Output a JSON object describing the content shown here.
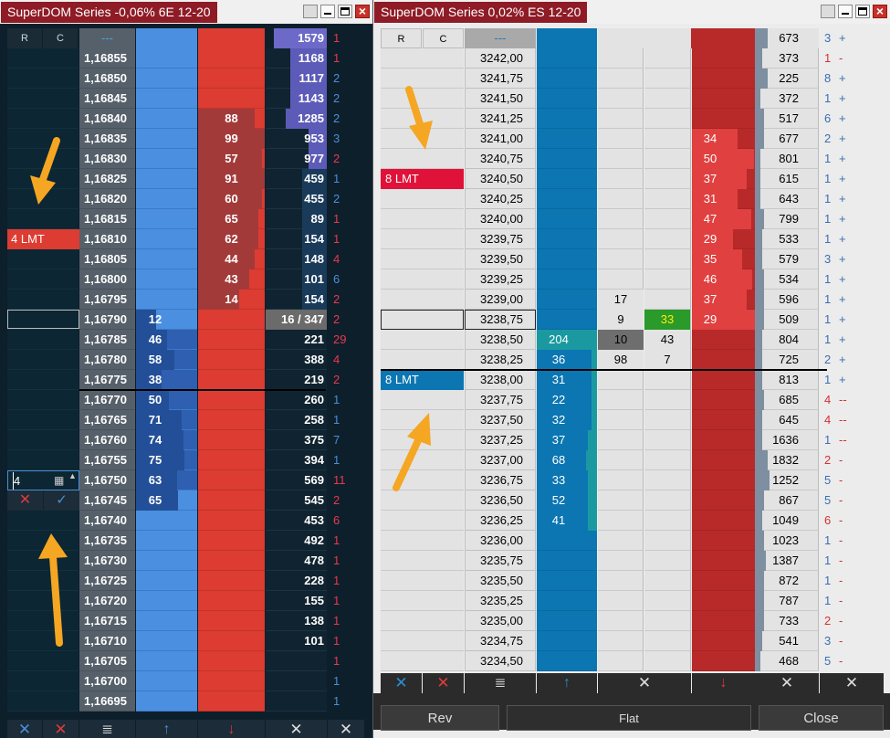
{
  "left": {
    "title": "SuperDOM Series -0,06% 6E 12-20",
    "header": {
      "r": "R",
      "c": "C",
      "price": "---",
      "top_ask": "1579",
      "top_cnt": "1"
    },
    "order_label": "4 LMT",
    "qty_value": "4",
    "rows": [
      {
        "p": "1,16855",
        "ask": "",
        "bid": "",
        "vol": "1168",
        "cnt": "1"
      },
      {
        "p": "1,16850",
        "ask": "",
        "bid": "",
        "vol": "1117",
        "cnt": "2"
      },
      {
        "p": "1,16845",
        "ask": "",
        "bid": "",
        "vol": "1143",
        "cnt": "2"
      },
      {
        "p": "1,16840",
        "ask": "88",
        "bid": "",
        "vol": "1285",
        "cnt": "2"
      },
      {
        "p": "1,16835",
        "ask": "99",
        "bid": "",
        "vol": "953",
        "cnt": "3"
      },
      {
        "p": "1,16830",
        "ask": "57",
        "bid": "",
        "vol": "977",
        "cnt": "2"
      },
      {
        "p": "1,16825",
        "ask": "91",
        "bid": "",
        "vol": "459",
        "cnt": "1"
      },
      {
        "p": "1,16820",
        "ask": "60",
        "bid": "",
        "vol": "455",
        "cnt": "2"
      },
      {
        "p": "1,16815",
        "ask": "65",
        "bid": "",
        "vol": "89",
        "cnt": "1"
      },
      {
        "p": "1,16810",
        "ask": "62",
        "bid": "",
        "vol": "154",
        "cnt": "1"
      },
      {
        "p": "1,16805",
        "ask": "44",
        "bid": "",
        "vol": "148",
        "cnt": "4"
      },
      {
        "p": "1,16800",
        "ask": "43",
        "bid": "",
        "vol": "101",
        "cnt": "6"
      },
      {
        "p": "1,16795",
        "ask": "14",
        "bid": "",
        "vol": "154",
        "cnt": "2"
      },
      {
        "p": "1,16790",
        "ask": "",
        "bid": "12",
        "vol": "16 / 347",
        "cnt": "2"
      },
      {
        "p": "1,16785",
        "ask": "",
        "bid": "46",
        "vol": "221",
        "cnt": "29"
      },
      {
        "p": "1,16780",
        "ask": "",
        "bid": "58",
        "vol": "388",
        "cnt": "4"
      },
      {
        "p": "1,16775",
        "ask": "",
        "bid": "38",
        "vol": "219",
        "cnt": "2"
      },
      {
        "p": "1,16770",
        "ask": "",
        "bid": "50",
        "vol": "260",
        "cnt": "1"
      },
      {
        "p": "1,16765",
        "ask": "",
        "bid": "71",
        "vol": "258",
        "cnt": "1"
      },
      {
        "p": "1,16760",
        "ask": "",
        "bid": "74",
        "vol": "375",
        "cnt": "7"
      },
      {
        "p": "1,16755",
        "ask": "",
        "bid": "75",
        "vol": "394",
        "cnt": "1"
      },
      {
        "p": "1,16750",
        "ask": "",
        "bid": "63",
        "vol": "569",
        "cnt": "11"
      },
      {
        "p": "1,16745",
        "ask": "",
        "bid": "65",
        "vol": "545",
        "cnt": "2"
      },
      {
        "p": "1,16740",
        "ask": "",
        "bid": "",
        "vol": "453",
        "cnt": "6"
      },
      {
        "p": "1,16735",
        "ask": "",
        "bid": "",
        "vol": "492",
        "cnt": "1"
      },
      {
        "p": "1,16730",
        "ask": "",
        "bid": "",
        "vol": "478",
        "cnt": "1"
      },
      {
        "p": "1,16725",
        "ask": "",
        "bid": "",
        "vol": "228",
        "cnt": "1"
      },
      {
        "p": "1,16720",
        "ask": "",
        "bid": "",
        "vol": "155",
        "cnt": "1"
      },
      {
        "p": "1,16715",
        "ask": "",
        "bid": "",
        "vol": "138",
        "cnt": "1"
      },
      {
        "p": "1,16710",
        "ask": "",
        "bid": "",
        "vol": "101",
        "cnt": "1"
      },
      {
        "p": "1,16705",
        "ask": "",
        "bid": "",
        "vol": "",
        "cnt": "1"
      },
      {
        "p": "1,16700",
        "ask": "",
        "bid": "",
        "vol": "",
        "cnt": "1"
      },
      {
        "p": "1,16695",
        "ask": "",
        "bid": "",
        "vol": "",
        "cnt": "1"
      }
    ]
  },
  "right": {
    "title": "SuperDOM Series 0,02% ES 12-20",
    "header": {
      "r": "R",
      "c": "C",
      "price": "---",
      "vol": "673",
      "cnt": "3",
      "sign": "+"
    },
    "order_label_sell": "8 LMT",
    "order_label_buy": "8 LMT",
    "rows": [
      {
        "p": "3242,00",
        "b1": "",
        "b2": "",
        "b3": "",
        "ask": "",
        "vol": "373",
        "cnt": "1",
        "sign": "-"
      },
      {
        "p": "3241,75",
        "b1": "",
        "b2": "",
        "b3": "",
        "ask": "",
        "vol": "225",
        "cnt": "8",
        "sign": "+"
      },
      {
        "p": "3241,50",
        "b1": "",
        "b2": "",
        "b3": "",
        "ask": "",
        "vol": "372",
        "cnt": "1",
        "sign": "+"
      },
      {
        "p": "3241,25",
        "b1": "",
        "b2": "",
        "b3": "",
        "ask": "",
        "vol": "517",
        "cnt": "6",
        "sign": "+"
      },
      {
        "p": "3241,00",
        "b1": "",
        "b2": "",
        "b3": "",
        "ask": "34",
        "vol": "677",
        "cnt": "2",
        "sign": "+"
      },
      {
        "p": "3240,75",
        "b1": "",
        "b2": "",
        "b3": "",
        "ask": "50",
        "vol": "801",
        "cnt": "1",
        "sign": "+"
      },
      {
        "p": "3240,50",
        "b1": "",
        "b2": "",
        "b3": "",
        "ask": "37",
        "vol": "615",
        "cnt": "1",
        "sign": "+"
      },
      {
        "p": "3240,25",
        "b1": "",
        "b2": "",
        "b3": "",
        "ask": "31",
        "vol": "643",
        "cnt": "1",
        "sign": "+"
      },
      {
        "p": "3240,00",
        "b1": "",
        "b2": "",
        "b3": "",
        "ask": "47",
        "vol": "799",
        "cnt": "1",
        "sign": "+"
      },
      {
        "p": "3239,75",
        "b1": "",
        "b2": "",
        "b3": "",
        "ask": "29",
        "vol": "533",
        "cnt": "1",
        "sign": "+"
      },
      {
        "p": "3239,50",
        "b1": "",
        "b2": "",
        "b3": "",
        "ask": "35",
        "vol": "579",
        "cnt": "3",
        "sign": "+"
      },
      {
        "p": "3239,25",
        "b1": "",
        "b2": "",
        "b3": "",
        "ask": "46",
        "vol": "534",
        "cnt": "1",
        "sign": "+"
      },
      {
        "p": "3239,00",
        "b1": "",
        "b2": "17",
        "b3": "",
        "ask": "37",
        "vol": "596",
        "cnt": "1",
        "sign": "+"
      },
      {
        "p": "3238,75",
        "b1": "",
        "b2": "9",
        "b3": "33",
        "ask": "29",
        "vol": "509",
        "cnt": "1",
        "sign": "+"
      },
      {
        "p": "3238,50",
        "b1": "204",
        "b2": "10",
        "b3": "43",
        "ask": "",
        "vol": "804",
        "cnt": "1",
        "sign": "+"
      },
      {
        "p": "3238,25",
        "b1": "36",
        "b2": "98",
        "b3": "7",
        "ask": "",
        "vol": "725",
        "cnt": "2",
        "sign": "+"
      },
      {
        "p": "3238,00",
        "b1": "31",
        "b2": "",
        "b3": "",
        "ask": "",
        "vol": "813",
        "cnt": "1",
        "sign": "+"
      },
      {
        "p": "3237,75",
        "b1": "22",
        "b2": "",
        "b3": "",
        "ask": "",
        "vol": "685",
        "cnt": "4",
        "sign": "--"
      },
      {
        "p": "3237,50",
        "b1": "32",
        "b2": "",
        "b3": "",
        "ask": "",
        "vol": "645",
        "cnt": "4",
        "sign": "--"
      },
      {
        "p": "3237,25",
        "b1": "37",
        "b2": "",
        "b3": "",
        "ask": "",
        "vol": "1636",
        "cnt": "1",
        "sign": "--"
      },
      {
        "p": "3237,00",
        "b1": "68",
        "b2": "",
        "b3": "",
        "ask": "",
        "vol": "1832",
        "cnt": "2",
        "sign": "-"
      },
      {
        "p": "3236,75",
        "b1": "33",
        "b2": "",
        "b3": "",
        "ask": "",
        "vol": "1252",
        "cnt": "5",
        "sign": "-"
      },
      {
        "p": "3236,50",
        "b1": "52",
        "b2": "",
        "b3": "",
        "ask": "",
        "vol": "867",
        "cnt": "5",
        "sign": "-"
      },
      {
        "p": "3236,25",
        "b1": "41",
        "b2": "",
        "b3": "",
        "ask": "",
        "vol": "1049",
        "cnt": "6",
        "sign": "-"
      },
      {
        "p": "3236,00",
        "b1": "",
        "b2": "",
        "b3": "",
        "ask": "",
        "vol": "1023",
        "cnt": "1",
        "sign": "-"
      },
      {
        "p": "3235,75",
        "b1": "",
        "b2": "",
        "b3": "",
        "ask": "",
        "vol": "1387",
        "cnt": "1",
        "sign": "-"
      },
      {
        "p": "3235,50",
        "b1": "",
        "b2": "",
        "b3": "",
        "ask": "",
        "vol": "872",
        "cnt": "1",
        "sign": "-"
      },
      {
        "p": "3235,25",
        "b1": "",
        "b2": "",
        "b3": "",
        "ask": "",
        "vol": "787",
        "cnt": "1",
        "sign": "-"
      },
      {
        "p": "3235,00",
        "b1": "",
        "b2": "",
        "b3": "",
        "ask": "",
        "vol": "733",
        "cnt": "2",
        "sign": "-"
      },
      {
        "p": "3234,75",
        "b1": "",
        "b2": "",
        "b3": "",
        "ask": "",
        "vol": "541",
        "cnt": "3",
        "sign": "-"
      },
      {
        "p": "3234,50",
        "b1": "",
        "b2": "",
        "b3": "",
        "ask": "",
        "vol": "468",
        "cnt": "5",
        "sign": "-"
      }
    ],
    "buttons": {
      "rev": "Rev",
      "flat": "Flat",
      "close": "Close"
    }
  },
  "colors": {
    "blue": "#4b8fe0",
    "red": "#dc3c32",
    "es_blue": "#0b76b2",
    "es_red": "#b82a2a",
    "arrow": "#f5a623"
  }
}
